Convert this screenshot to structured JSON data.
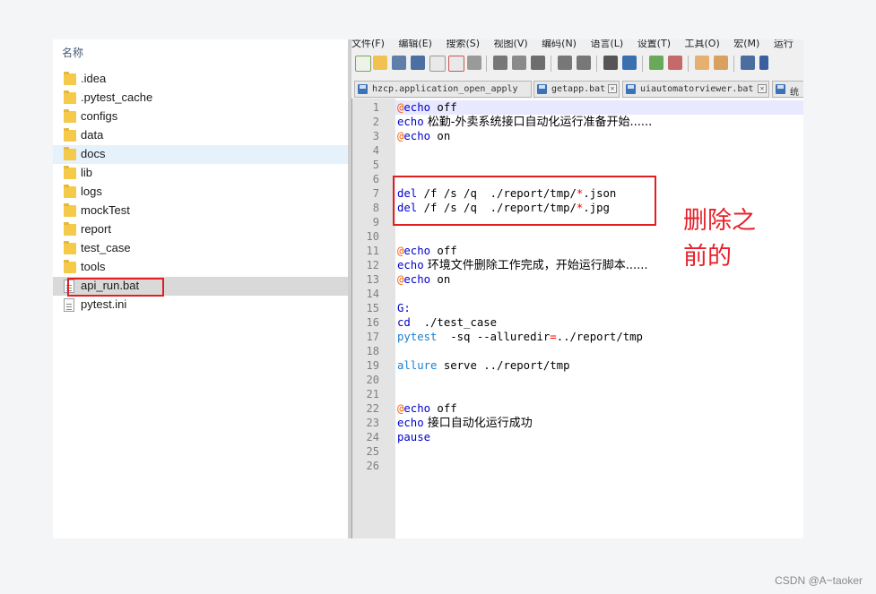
{
  "explorer": {
    "column_header": "名称",
    "items": [
      {
        "name": ".idea",
        "type": "folder"
      },
      {
        "name": ".pytest_cache",
        "type": "folder"
      },
      {
        "name": "configs",
        "type": "folder"
      },
      {
        "name": "data",
        "type": "folder"
      },
      {
        "name": "docs",
        "type": "folder"
      },
      {
        "name": "lib",
        "type": "folder"
      },
      {
        "name": "logs",
        "type": "folder"
      },
      {
        "name": "mockTest",
        "type": "folder"
      },
      {
        "name": "report",
        "type": "folder"
      },
      {
        "name": "test_case",
        "type": "folder"
      },
      {
        "name": "tools",
        "type": "folder"
      },
      {
        "name": "api_run.bat",
        "type": "file"
      },
      {
        "name": "pytest.ini",
        "type": "file"
      }
    ]
  },
  "editor": {
    "menu": [
      "文件(F)",
      "编辑(E)",
      "搜索(S)",
      "视图(V)",
      "编码(N)",
      "语言(L)",
      "设置(T)",
      "工具(O)",
      "宏(M)",
      "运行"
    ],
    "tabs": [
      {
        "label": "hzcp.application_open_apply"
      },
      {
        "label": "getapp.bat"
      },
      {
        "label": "uiautomatorviewer.bat"
      },
      {
        "label": "统"
      }
    ],
    "line_numbers": [
      "1",
      "2",
      "3",
      "4",
      "5",
      "6",
      "7",
      "8",
      "9",
      "10",
      "11",
      "12",
      "13",
      "14",
      "15",
      "16",
      "17",
      "18",
      "19",
      "20",
      "21",
      "22",
      "23",
      "24",
      "25",
      "26"
    ],
    "code": {
      "l1_at": "@",
      "l1_kw": "echo",
      "l1_rest": " off",
      "l2_kw": "echo",
      "l2_rest": " 松勤-外卖系统接口自动化运行准备开始......",
      "l3_at": "@",
      "l3_kw": "echo",
      "l3_rest": " on",
      "l7_kw": "del",
      "l7_a": " /f /s /q  ./report/tmp/",
      "l7_star": "*",
      "l7_b": ".json",
      "l8_kw": "del",
      "l8_a": " /f /s /q  ./report/tmp/",
      "l8_star": "*",
      "l8_b": ".jpg",
      "l11_at": "@",
      "l11_kw": "echo",
      "l11_rest": " off",
      "l12_kw": "echo",
      "l12_rest": " 环境文件删除工作完成，开始运行脚本......",
      "l13_at": "@",
      "l13_kw": "echo",
      "l13_rest": " on",
      "l15_kw": "G:",
      "l16_kw": "cd",
      "l16_rest": "  ./test_case",
      "l17_kw": "pytest",
      "l17_a": "  -sq --alluredir",
      "l17_eq": "=",
      "l17_b": "../report/tmp",
      "l19_kw": "allure",
      "l19_rest": " serve ../report/tmp",
      "l22_at": "@",
      "l22_kw": "echo",
      "l22_rest": " off",
      "l23_kw": "echo",
      "l23_rest": " 接口自动化运行成功",
      "l24_kw": "pause"
    }
  },
  "annotation": {
    "line1": "删除之",
    "line2": "前的"
  },
  "watermark": "CSDN @A~taoker",
  "colors": {
    "keyword": "#0000cc",
    "at_sign": "#ff5a00",
    "highlight_box": "#e02020",
    "annotation": "#e8202a"
  }
}
